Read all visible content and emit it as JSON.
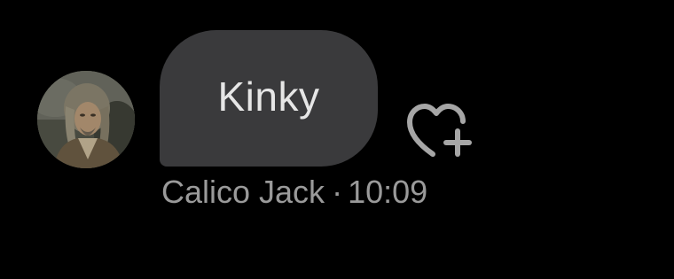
{
  "message": {
    "text": "Kinky",
    "sender": "Calico Jack",
    "separator": "·",
    "time": "10:09"
  },
  "icons": {
    "avatar": "user-avatar-photo",
    "reaction": "heart-plus-icon"
  },
  "colors": {
    "background": "#000000",
    "bubble": "#3a3a3c",
    "bubble_text": "#e6e6e6",
    "meta_text": "#9a9a9a",
    "icon": "#a6a6a6"
  }
}
